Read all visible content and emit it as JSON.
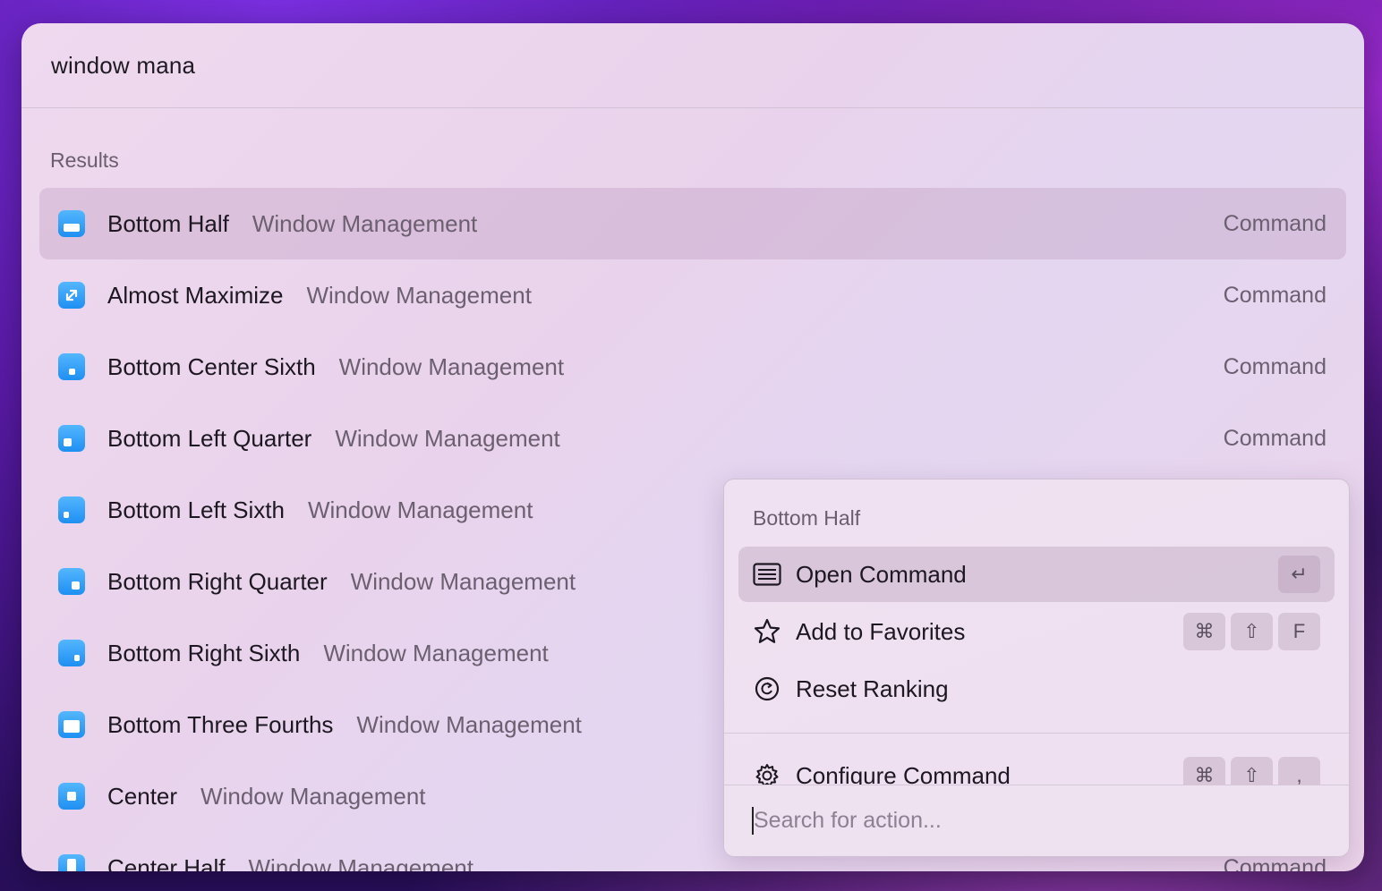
{
  "search": {
    "query": "window mana"
  },
  "results": {
    "section_label": "Results",
    "items": [
      {
        "title": "Bottom Half",
        "subtitle": "Window Management",
        "kind": "Command",
        "icon": "bottom-half-icon"
      },
      {
        "title": "Almost Maximize",
        "subtitle": "Window Management",
        "kind": "Command",
        "icon": "almost-maximize-icon"
      },
      {
        "title": "Bottom Center Sixth",
        "subtitle": "Window Management",
        "kind": "Command",
        "icon": "bottom-center-sixth-icon"
      },
      {
        "title": "Bottom Left Quarter",
        "subtitle": "Window Management",
        "kind": "Command",
        "icon": "bottom-left-quarter-icon"
      },
      {
        "title": "Bottom Left Sixth",
        "subtitle": "Window Management",
        "kind": "",
        "icon": "bottom-left-sixth-icon"
      },
      {
        "title": "Bottom Right Quarter",
        "subtitle": "Window Management",
        "kind": "",
        "icon": "bottom-right-quarter-icon"
      },
      {
        "title": "Bottom Right Sixth",
        "subtitle": "Window Management",
        "kind": "",
        "icon": "bottom-right-sixth-icon"
      },
      {
        "title": "Bottom Three Fourths",
        "subtitle": "Window Management",
        "kind": "",
        "icon": "bottom-three-fourths-icon"
      },
      {
        "title": "Center",
        "subtitle": "Window Management",
        "kind": "",
        "icon": "center-icon"
      },
      {
        "title": "Center Half",
        "subtitle": "Window Management",
        "kind": "Command",
        "icon": "center-half-icon"
      }
    ]
  },
  "action_panel": {
    "title": "Bottom Half",
    "actions": [
      {
        "label": "Open Command",
        "icon": "list-icon",
        "keys": [
          "↵"
        ]
      },
      {
        "label": "Add to Favorites",
        "icon": "star-icon",
        "keys": [
          "⌘",
          "⇧",
          "F"
        ]
      },
      {
        "label": "Reset Ranking",
        "icon": "reset-icon",
        "keys": []
      },
      {
        "label": "Configure Command",
        "icon": "gear-icon",
        "keys": [
          "⌘",
          "⇧",
          ","
        ]
      }
    ],
    "search_placeholder": "Search for action..."
  },
  "colors": {
    "accent_icon": "#1e8ff2",
    "window_bg": "#ecd6ee"
  }
}
